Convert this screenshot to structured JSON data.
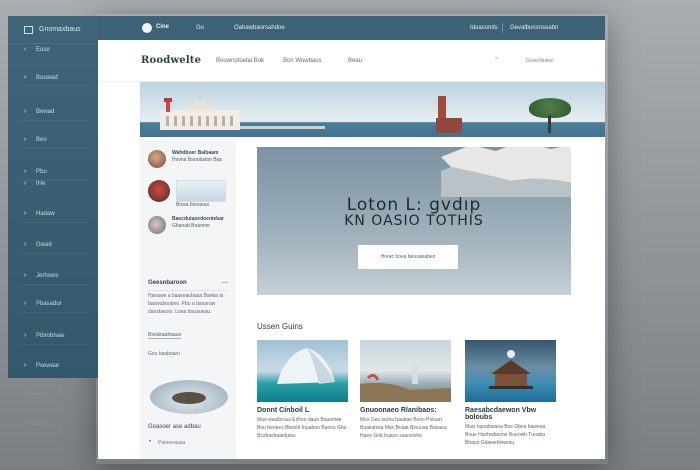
{
  "sidebar": {
    "brand": "Gnomaxbaus",
    "items": [
      {
        "icon": "chevron",
        "label": "Euse"
      },
      {
        "icon": "chevron",
        "label": "Bouwad"
      },
      {
        "icon": "chevron",
        "label": "Bewad"
      },
      {
        "icon": "chevron",
        "label": "Beo"
      },
      {
        "icon": "chevron",
        "label": "Pbu"
      },
      {
        "icon": "chevron",
        "label": "IHe"
      },
      {
        "icon": "chevron",
        "label": "Hadaw"
      },
      {
        "icon": "chevron",
        "label": "Gwad"
      },
      {
        "icon": "chevron",
        "label": "Jerhows"
      },
      {
        "icon": "chevron",
        "label": "Pbasadur"
      },
      {
        "icon": "chevron",
        "label": "Pibrobnaw"
      },
      {
        "icon": "chevron",
        "label": "Pxewaar"
      }
    ],
    "below": [
      "Oouanoan",
      "Gbasieon"
    ]
  },
  "topbar": {
    "brand": "Cine",
    "nav": [
      "Go",
      "Oahawbaorsahdoe"
    ],
    "right": [
      "Idoasonds",
      "Gevalbunsnsoabn"
    ]
  },
  "header": {
    "site_name": "Roodwelte",
    "nav": [
      "Bouwnotoelal Bok",
      "Bon Wuwbaus",
      "Beau"
    ],
    "search_label": "Goveclbatoc"
  },
  "leftcol": {
    "thumbs": [
      {
        "title": "Wahdboer Balbaam",
        "line": "Hovna Baoobaton Bas"
      },
      {
        "title": "",
        "line": "Bowa bonaeas"
      },
      {
        "title": "Baecdutasedoeniebar",
        "line": "Gbanab Boannor"
      }
    ],
    "heading": "Geesnbaroon",
    "para1": "Hanawe a baaseaubaaa Baeba la baswuboobeo. Fbu a banaruw daosbaoso. Loaa bouaueau.",
    "link": "Bsoukauhaauo",
    "para2": "Geu baaboaru",
    "caption": "Goasoer ase adbau",
    "sub": "Paoeerauaa"
  },
  "hero": {
    "line1": "Loton L: gvdıp",
    "line2": "KN  OASIO TOTHIS",
    "cta": "Hreac hoea beusaeaben"
  },
  "section_title": "Ussen Guins",
  "cards": [
    {
      "title": "Donnt Cinboil L",
      "text": "Mao waulbruus Eshoo dauo Bauemxe Bou benees Bbwob Inuaboo Baoeo Gho Bcahasbaaebaos"
    },
    {
      "title": "Gnuoonaeo Rlanibaos:",
      "text": "Mos Ges taoha baubae Boco Poluan Buakanwa Mas Boaat Blouuau Basaoa Haeo Gob buaco saunsiohe"
    },
    {
      "title": "Raesabcdaewon Vbw boloubs",
      "text": "Mais baoabwaoa Bos Gbea baweaa Boue Hanhwboone Bueowh Tuoaba Bhauo Gdaweblowrau"
    }
  ],
  "colors": {
    "sidebar": "#3f6478",
    "topbar": "#3d6275",
    "accent": "#3d6275"
  }
}
